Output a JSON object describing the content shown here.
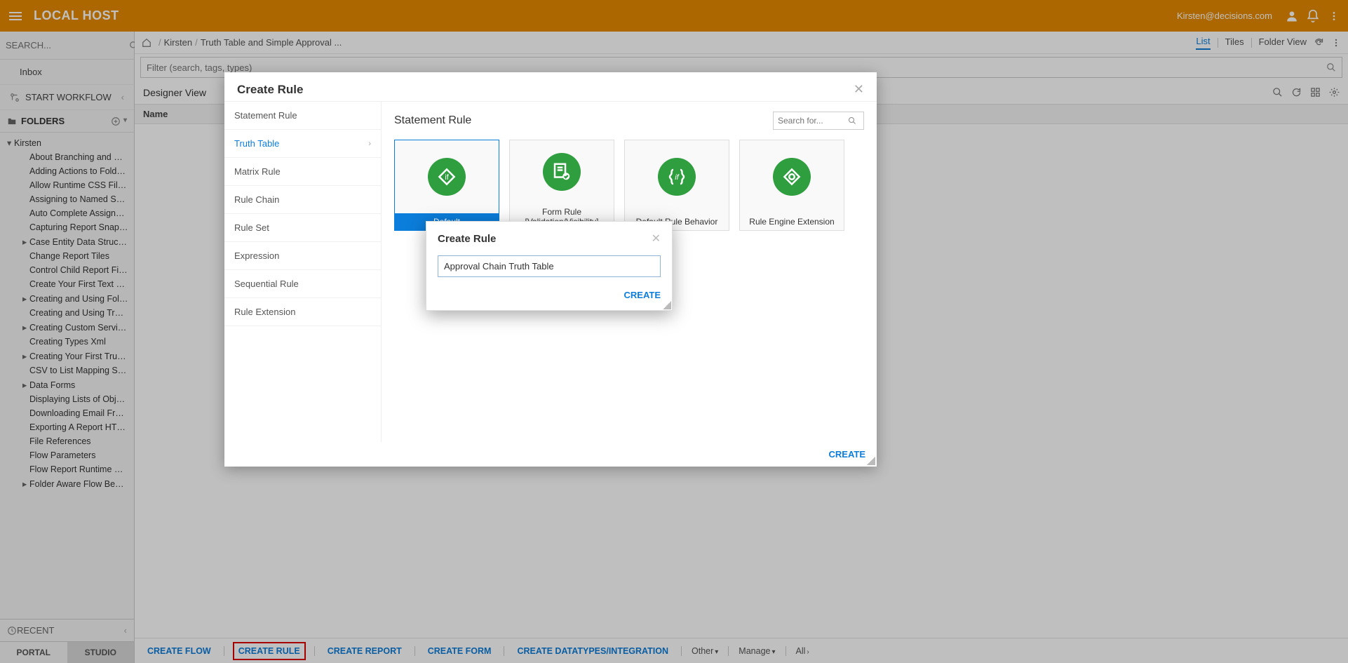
{
  "topbar": {
    "brand": "LOCAL HOST",
    "user": "Kirsten@decisions.com"
  },
  "sidebar": {
    "search_placeholder": "SEARCH...",
    "inbox_label": "Inbox",
    "start_workflow_label": "START WORKFLOW",
    "folders_label": "FOLDERS",
    "recent_label": "RECENT",
    "tabs": {
      "portal": "PORTAL",
      "studio": "STUDIO"
    },
    "tree_root": "Kirsten",
    "tree": [
      {
        "label": "About Branching and Merging Fl",
        "exp": false
      },
      {
        "label": "Adding Actions to Folder Extens",
        "exp": false
      },
      {
        "label": "Allow Runtime CSS File Name",
        "exp": false
      },
      {
        "label": "Assigning to Named Sessions",
        "exp": false
      },
      {
        "label": "Auto Complete Assigned Form",
        "exp": false
      },
      {
        "label": "Capturing Report Snapshot",
        "exp": false
      },
      {
        "label": "Case Entity Data Structure",
        "exp": true
      },
      {
        "label": "Change Report Tiles",
        "exp": false
      },
      {
        "label": "Control Child Report Filter Value",
        "exp": false
      },
      {
        "label": "Create Your First Text Merge",
        "exp": false
      },
      {
        "label": "Creating and Using Folder Exten",
        "exp": true
      },
      {
        "label": "Creating and Using Truth Tables",
        "exp": false
      },
      {
        "label": "Creating Custom Service Catalo",
        "exp": true
      },
      {
        "label": "Creating Types Xml",
        "exp": false
      },
      {
        "label": "Creating Your First Truth Table",
        "exp": true
      },
      {
        "label": "CSV to List Mapping Step",
        "exp": false
      },
      {
        "label": "Data Forms",
        "exp": true
      },
      {
        "label": "Displaying Lists of Objects In A",
        "exp": false
      },
      {
        "label": "Downloading Email From a Mail",
        "exp": false
      },
      {
        "label": "Exporting A Report HTML",
        "exp": false
      },
      {
        "label": "File References",
        "exp": false
      },
      {
        "label": "Flow Parameters",
        "exp": false
      },
      {
        "label": "Flow Report Runtime Filters",
        "exp": false
      },
      {
        "label": "Folder Aware Flow Behavior",
        "exp": true
      }
    ]
  },
  "crumbs": {
    "p1": "Kirsten",
    "p2": "Truth Table and Simple Approval ...",
    "views": {
      "list": "List",
      "tiles": "Tiles",
      "folder": "Folder View"
    }
  },
  "filter_placeholder": "Filter (search, tags, types)",
  "designer": {
    "title": "Designer View",
    "col1": "Name"
  },
  "actions": {
    "create_flow": "CREATE FLOW",
    "create_rule": "CREATE RULE",
    "create_report": "CREATE REPORT",
    "create_form": "CREATE FORM",
    "create_dt": "CREATE DATATYPES/INTEGRATION",
    "other": "Other",
    "manage": "Manage",
    "all": "All"
  },
  "dlg1": {
    "title": "Create Rule",
    "right_title": "Statement Rule",
    "search_placeholder": "Search for...",
    "types": [
      "Statement Rule",
      "Truth Table",
      "Matrix Rule",
      "Rule Chain",
      "Rule Set",
      "Expression",
      "Sequential Rule",
      "Rule Extension"
    ],
    "cards": [
      {
        "label": "Default",
        "icon": "if-diamond",
        "selected": true
      },
      {
        "label": "Form Rule [Validation/Visibility]",
        "icon": "form-check",
        "selected": false
      },
      {
        "label": "Default Rule Behavior",
        "icon": "if-braces",
        "selected": false
      },
      {
        "label": "Rule Engine Extension",
        "icon": "engine",
        "selected": false
      }
    ],
    "create_btn": "CREATE"
  },
  "dlg2": {
    "title": "Create Rule",
    "value": "Approval Chain Truth Table",
    "create_btn": "CREATE"
  }
}
